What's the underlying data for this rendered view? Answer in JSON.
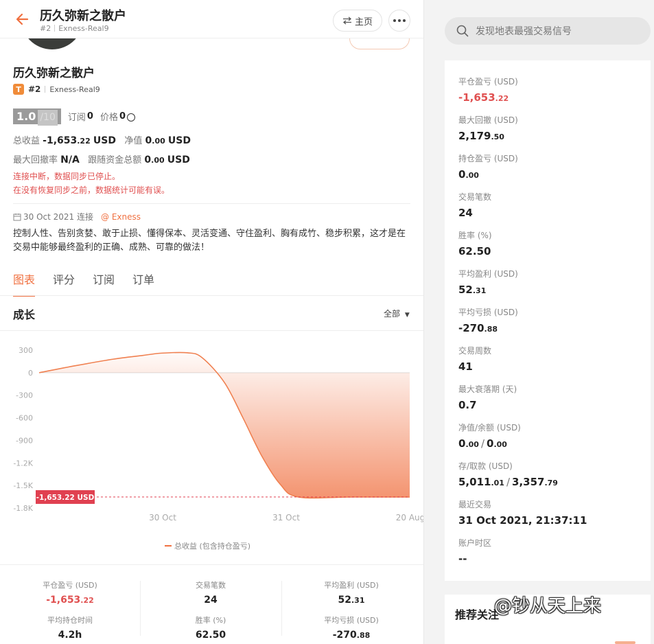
{
  "header": {
    "title": "历久弥新之散户",
    "rank": "#2",
    "account": "Exness-Real9",
    "home_label": "主页"
  },
  "profile": {
    "name": "历久弥新之散户",
    "badge": "T",
    "rank": "#2",
    "account": "Exness-Real9",
    "score": "1.0",
    "score_max": "/10",
    "subscribe_label": "订阅",
    "subscribe_count": "0",
    "price_label": "价格",
    "price_value": "0",
    "total_profit_label": "总收益",
    "total_profit_int": "-1,653",
    "total_profit_dec": ".22",
    "total_profit_unit": "USD",
    "equity_label": "净值",
    "equity_int": "0",
    "equity_dec": ".00",
    "equity_unit": "USD",
    "max_dd_label": "最大回撤率",
    "max_dd_value": "N/A",
    "follow_label": "跟随资金总额",
    "follow_int": "0",
    "follow_dec": ".00",
    "follow_unit": "USD",
    "warning_1": "连接中断，数据同步已停止。",
    "warning_2": "在没有恢复同步之前，数据统计可能有误。",
    "connect_date": "30 Oct 2021 连接",
    "broker": "@ Exness",
    "description": "控制人性、告别贪婪、敢于止损、懂得保本、灵活变通、守住盈利、胸有成竹、稳步积累，这才是在交易中能够最终盈利的正确、成熟、可靠的做法！"
  },
  "tabs": [
    {
      "label": "图表",
      "active": true
    },
    {
      "label": "评分",
      "active": false
    },
    {
      "label": "订阅",
      "active": false
    },
    {
      "label": "订单",
      "active": false
    }
  ],
  "growth": {
    "title": "成长",
    "range": "全部",
    "legend": "总收益 (包含持仓盈亏)",
    "current_label": "-1,653.22 USD"
  },
  "chart_data": {
    "type": "area",
    "title": "",
    "xlabel": "",
    "ylabel": "",
    "ylim": [
      -1800,
      300
    ],
    "yticks": [
      300,
      0,
      -300,
      -600,
      -900,
      -1200,
      -1500,
      -1800
    ],
    "ytick_labels": [
      "300",
      "0",
      "-300",
      "-600",
      "-900",
      "-1.2K",
      "-1.5K",
      "-1.8K"
    ],
    "xtick_labels": [
      "30 Oct",
      "31 Oct",
      "20 Aug"
    ],
    "series": [
      {
        "name": "总收益 (包含持仓盈亏)",
        "x": [
          0,
          0.1,
          0.2,
          0.28,
          0.33,
          0.4,
          0.44,
          0.5,
          0.55,
          0.6,
          0.65,
          0.7,
          0.85,
          1.0
        ],
        "values": [
          0,
          95,
          180,
          230,
          260,
          265,
          200,
          -130,
          -600,
          -1100,
          -1480,
          -1653.22,
          -1653.22,
          -1653.22
        ]
      }
    ],
    "colors": {
      "line": "#f08050",
      "area": "#f07040",
      "label_bg": "#e04050"
    }
  },
  "bottom_stats": [
    {
      "label": "平仓盈亏 (USD)",
      "int": "-1,653",
      "dec": ".22",
      "red": true
    },
    {
      "label": "交易笔数",
      "int": "24",
      "dec": "",
      "red": false
    },
    {
      "label": "平均盈利 (USD)",
      "int": "52",
      "dec": ".31",
      "red": false
    },
    {
      "label": "平均持仓时间",
      "int": "4.2h",
      "dec": "",
      "red": false
    },
    {
      "label": "胜率 (%)",
      "int": "62.50",
      "dec": "",
      "red": false
    },
    {
      "label": "平均亏损 (USD)",
      "int": "-270",
      "dec": ".88",
      "red": false
    }
  ],
  "sidebar": {
    "search_placeholder": "发现地表最强交易信号",
    "stats": [
      {
        "label": "平仓盈亏 (USD)",
        "int": "-1,653",
        "dec": ".22",
        "red": true
      },
      {
        "label": "最大回撤 (USD)",
        "int": "2,179",
        "dec": ".50",
        "red": false
      },
      {
        "label": "持仓盈亏 (USD)",
        "int": "0",
        "dec": ".00",
        "red": false
      },
      {
        "label": "交易笔数",
        "int": "24",
        "dec": "",
        "red": false
      },
      {
        "label": "胜率 (%)",
        "int": "62.50",
        "dec": "",
        "red": false
      },
      {
        "label": "平均盈利 (USD)",
        "int": "52",
        "dec": ".31",
        "red": false
      },
      {
        "label": "平均亏损 (USD)",
        "int": "-270",
        "dec": ".88",
        "red": false
      },
      {
        "label": "交易周数",
        "int": "41",
        "dec": "",
        "red": false
      },
      {
        "label": "最大衰落期 (天)",
        "int": "0.7",
        "dec": "",
        "red": false
      },
      {
        "label": "净值/余额 (USD)",
        "int": "0",
        "dec": ".00",
        "int2": "0",
        "dec2": ".00",
        "red": false
      },
      {
        "label": "存/取款 (USD)",
        "int": "5,011",
        "dec": ".01",
        "int2": "3,357",
        "dec2": ".79",
        "red": false
      },
      {
        "label": "最近交易",
        "int": "31 Oct 2021, 21:37:11",
        "dec": "",
        "red": false
      },
      {
        "label": "账户时区",
        "int": "--",
        "dec": "",
        "red": false
      }
    ],
    "recommend_title": "推荐关注",
    "watermark": "@钞从天上来"
  }
}
